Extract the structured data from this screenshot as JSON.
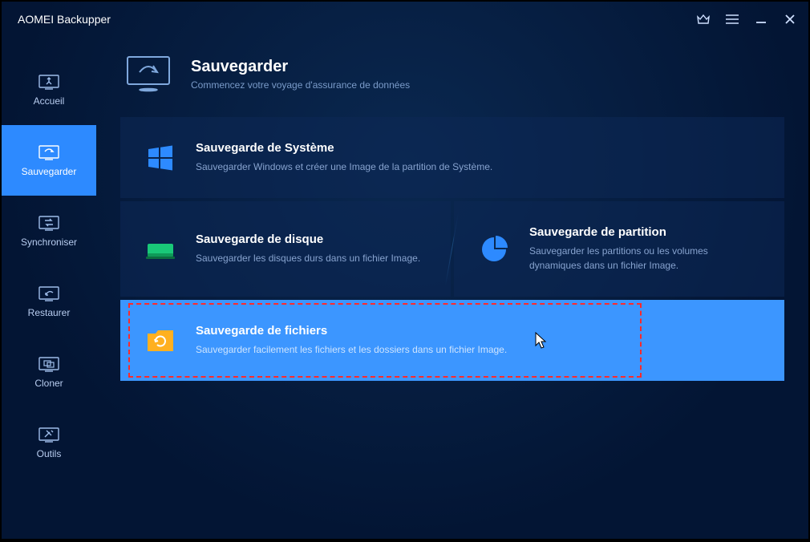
{
  "app": {
    "title": "AOMEI Backupper"
  },
  "sidebar": {
    "items": [
      {
        "label": "Accueil"
      },
      {
        "label": "Sauvegarder"
      },
      {
        "label": "Synchroniser"
      },
      {
        "label": "Restaurer"
      },
      {
        "label": "Cloner"
      },
      {
        "label": "Outils"
      }
    ]
  },
  "header": {
    "title": "Sauvegarder",
    "subtitle": "Commencez votre voyage d'assurance de données"
  },
  "cards": {
    "system": {
      "title": "Sauvegarde de Système",
      "desc": "Sauvegarder Windows et créer une Image de la partition de Système."
    },
    "disk": {
      "title": "Sauvegarde de disque",
      "desc": "Sauvegarder les disques durs dans un fichier Image."
    },
    "partition": {
      "title": "Sauvegarde de partition",
      "desc": "Sauvegarder les partitions ou les volumes dynamiques dans un fichier Image."
    },
    "files": {
      "title": "Sauvegarde de fichiers",
      "desc": "Sauvegarder facilement les fichiers et les dossiers dans un fichier Image."
    }
  }
}
